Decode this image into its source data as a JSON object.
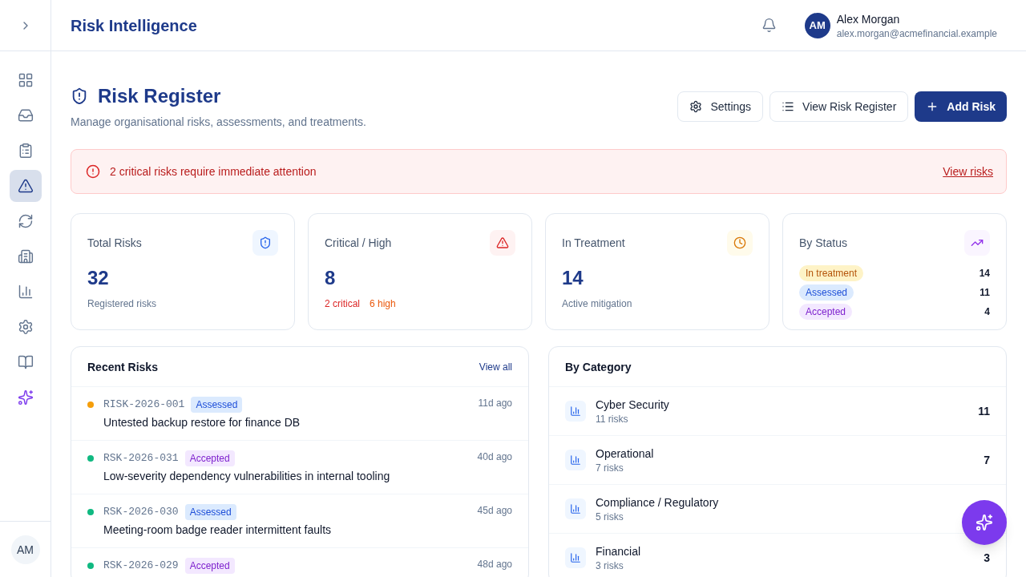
{
  "sidebar": {
    "nav": [
      {
        "selected": false
      },
      {
        "selected": false
      },
      {
        "selected": false
      },
      {
        "selected": true
      },
      {
        "selected": false
      },
      {
        "selected": false
      },
      {
        "selected": false
      },
      {
        "selected": false
      },
      {
        "selected": false
      },
      {
        "selected": false
      }
    ],
    "user_initials": "AM"
  },
  "header": {
    "title": "Risk Intelligence",
    "user": {
      "initials": "AM",
      "name": "Alex Morgan",
      "email": "alex.morgan@acmefinancial.example"
    }
  },
  "page": {
    "title": "Risk Register",
    "subtitle": "Manage organisational risks, assessments, and treatments.",
    "actions": [
      {
        "kind": "settings",
        "label": "Settings"
      },
      {
        "kind": "list",
        "label": "View Risk Register"
      },
      {
        "kind": "primary",
        "label": "Add Risk"
      }
    ]
  },
  "alert": {
    "message": "2 critical risks require immediate attention",
    "link": "View risks"
  },
  "stats": [
    {
      "kind": "total",
      "label": "Total Risks",
      "value": "32",
      "note": "Registered risks"
    },
    {
      "kind": "critical",
      "label": "Critical / High",
      "value": "8",
      "notes": [
        {
          "text": "2 critical",
          "color": "#dc2626"
        },
        {
          "text": "6 high",
          "color": "#ea580c"
        }
      ]
    },
    {
      "kind": "treatment",
      "label": "In Treatment",
      "value": "14",
      "note": "Active mitigation"
    },
    {
      "kind": "status",
      "label": "By Status",
      "statuses": [
        {
          "kind": "treatment",
          "label": "In treatment",
          "count": "14"
        },
        {
          "kind": "assessed",
          "label": "Assessed",
          "count": "11"
        },
        {
          "kind": "accepted",
          "label": "Accepted",
          "count": "4"
        }
      ]
    }
  ],
  "recent_risks": {
    "title": "Recent Risks",
    "link": "View all",
    "rows": [
      {
        "color": "#f59e0b",
        "id": "RISK-2026-001",
        "status": {
          "kind": "assessed",
          "label": "Assessed"
        },
        "age": "11d ago",
        "title": "Untested backup restore for finance DB"
      },
      {
        "color": "#10b981",
        "id": "RSK-2026-031",
        "status": {
          "kind": "accepted",
          "label": "Accepted"
        },
        "age": "40d ago",
        "title": "Low-severity dependency vulnerabilities in internal tooling"
      },
      {
        "color": "#10b981",
        "id": "RSK-2026-030",
        "status": {
          "kind": "assessed",
          "label": "Assessed"
        },
        "age": "45d ago",
        "title": "Meeting-room badge reader intermittent faults"
      },
      {
        "color": "#10b981",
        "id": "RSK-2026-029",
        "status": {
          "kind": "accepted",
          "label": "Accepted"
        },
        "age": "48d ago"
      }
    ]
  },
  "by_category": {
    "title": "By Category",
    "rows": [
      {
        "name": "Cyber Security",
        "note": "11 risks",
        "count": "11"
      },
      {
        "name": "Operational",
        "note": "7 risks",
        "count": "7"
      },
      {
        "name": "Compliance / Regulatory",
        "note": "5 risks"
      },
      {
        "name": "Financial",
        "note": "3 risks",
        "count": "3"
      }
    ]
  }
}
